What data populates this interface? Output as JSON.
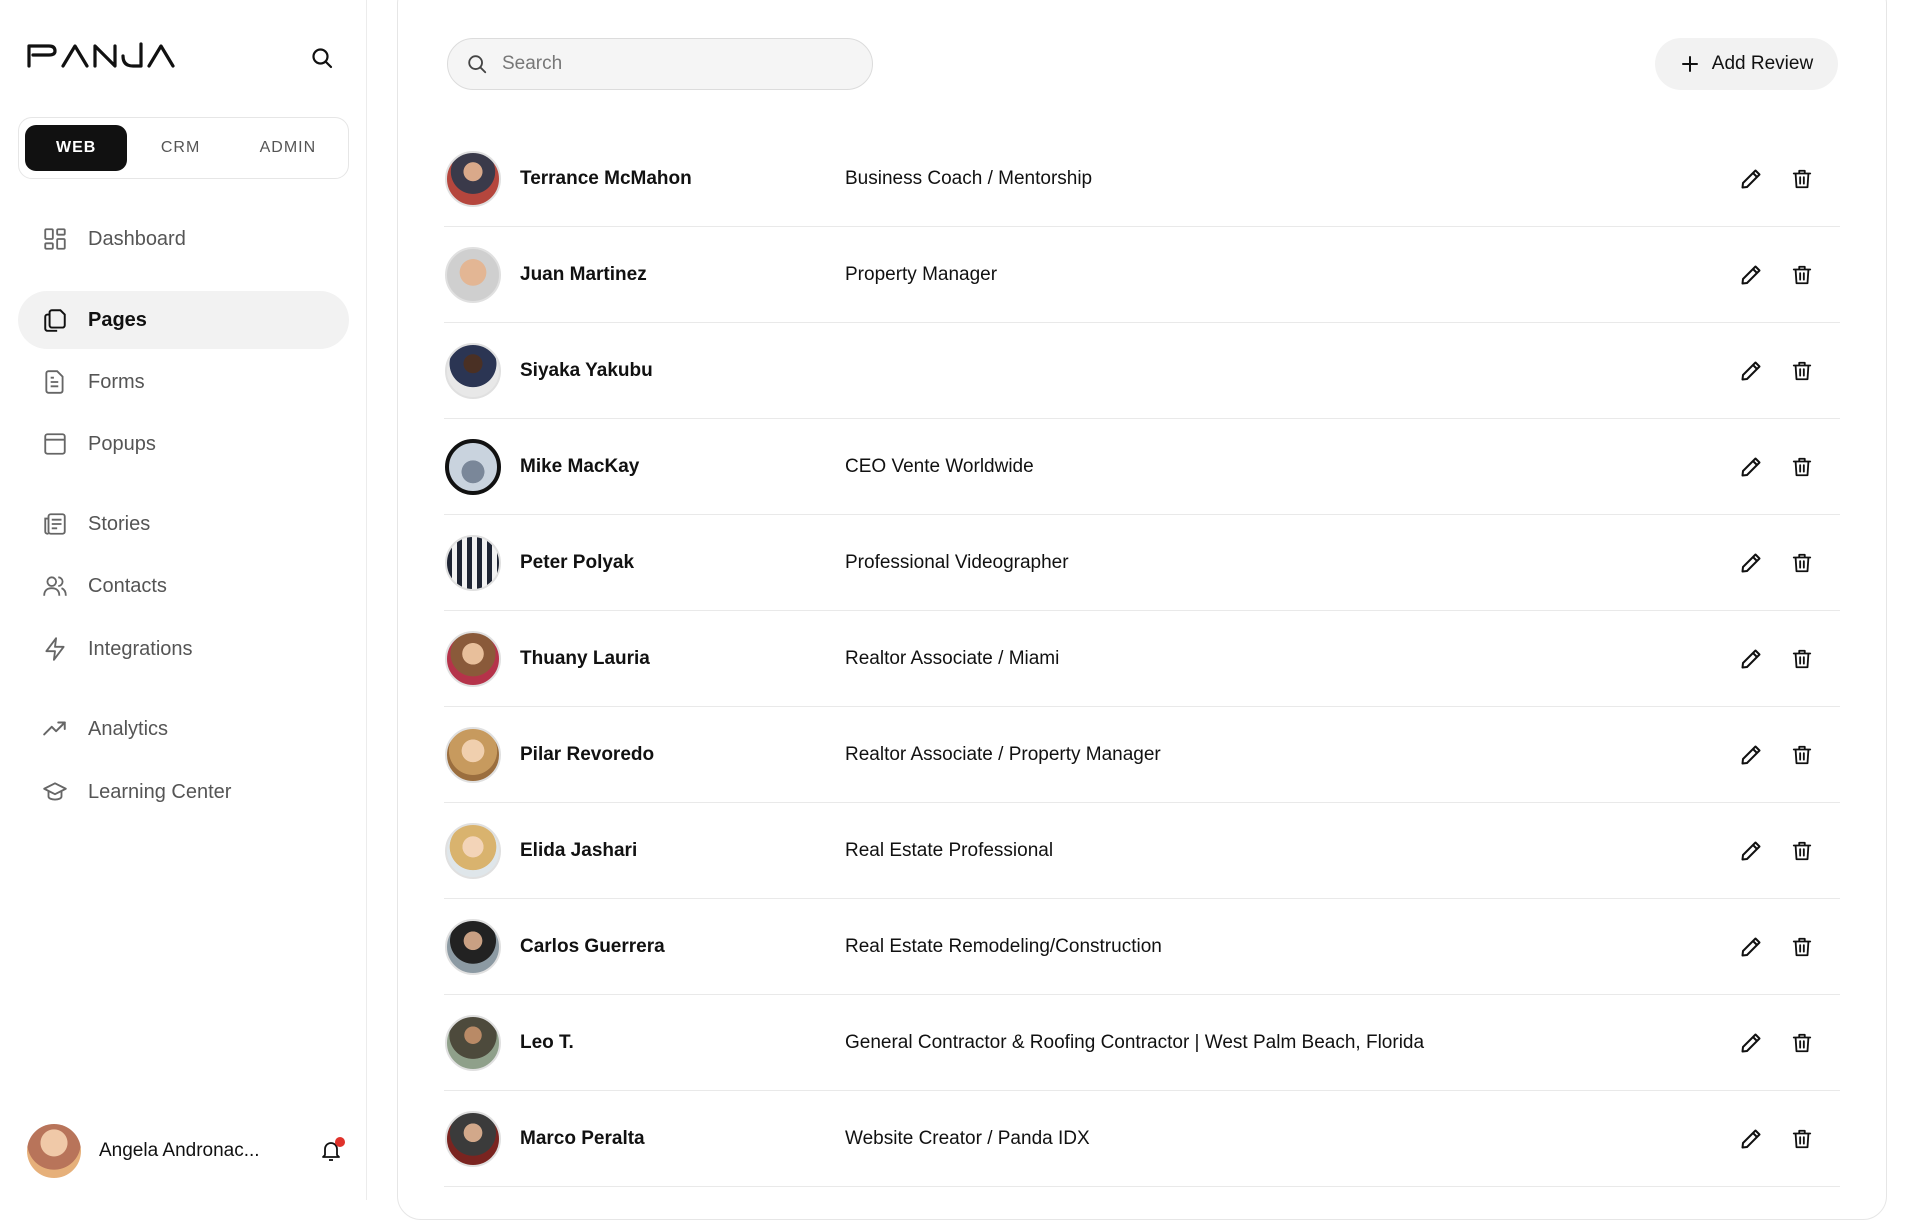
{
  "brand": {
    "name": "PANDA"
  },
  "colors": {
    "accent": "#111111",
    "notification": "#e0322b",
    "active_bg": "#f2f2f2"
  },
  "segments": [
    {
      "label": "WEB",
      "active": true
    },
    {
      "label": "CRM",
      "active": false
    },
    {
      "label": "ADMIN",
      "active": false
    }
  ],
  "nav": [
    {
      "label": "Dashboard",
      "icon": "dashboard-icon",
      "active": false
    },
    {
      "label": "Pages",
      "icon": "pages-icon",
      "active": true
    },
    {
      "label": "Forms",
      "icon": "forms-icon",
      "active": false
    },
    {
      "label": "Popups",
      "icon": "popups-icon",
      "active": false
    },
    {
      "label": "Stories",
      "icon": "stories-icon",
      "active": false
    },
    {
      "label": "Contacts",
      "icon": "contacts-icon",
      "active": false
    },
    {
      "label": "Integrations",
      "icon": "integrations-icon",
      "active": false
    },
    {
      "label": "Analytics",
      "icon": "analytics-icon",
      "active": false
    },
    {
      "label": "Learning Center",
      "icon": "learning-center-icon",
      "active": false
    }
  ],
  "user": {
    "name": "Angela Andronac...",
    "has_notification": true
  },
  "toolbar": {
    "search_placeholder": "Search",
    "add_label": "Add Review"
  },
  "reviews": [
    {
      "name": "Terrance McMahon",
      "role": "Business Coach / Mentorship"
    },
    {
      "name": "Juan Martinez",
      "role": "Property Manager"
    },
    {
      "name": "Siyaka Yakubu",
      "role": ""
    },
    {
      "name": "Mike MacKay",
      "role": "CEO Vente Worldwide"
    },
    {
      "name": "Peter Polyak",
      "role": "Professional Videographer"
    },
    {
      "name": "Thuany Lauria",
      "role": "Realtor Associate / Miami"
    },
    {
      "name": "Pilar Revoredo",
      "role": "Realtor Associate / Property Manager"
    },
    {
      "name": "Elida Jashari",
      "role": "Real Estate Professional"
    },
    {
      "name": "Carlos Guerrera",
      "role": "Real Estate Remodeling/Construction"
    },
    {
      "name": "Leo T.",
      "role": "General Contractor & Roofing Contractor | West Palm Beach, Florida"
    },
    {
      "name": "Marco Peralta",
      "role": "Website Creator / Panda IDX"
    }
  ]
}
